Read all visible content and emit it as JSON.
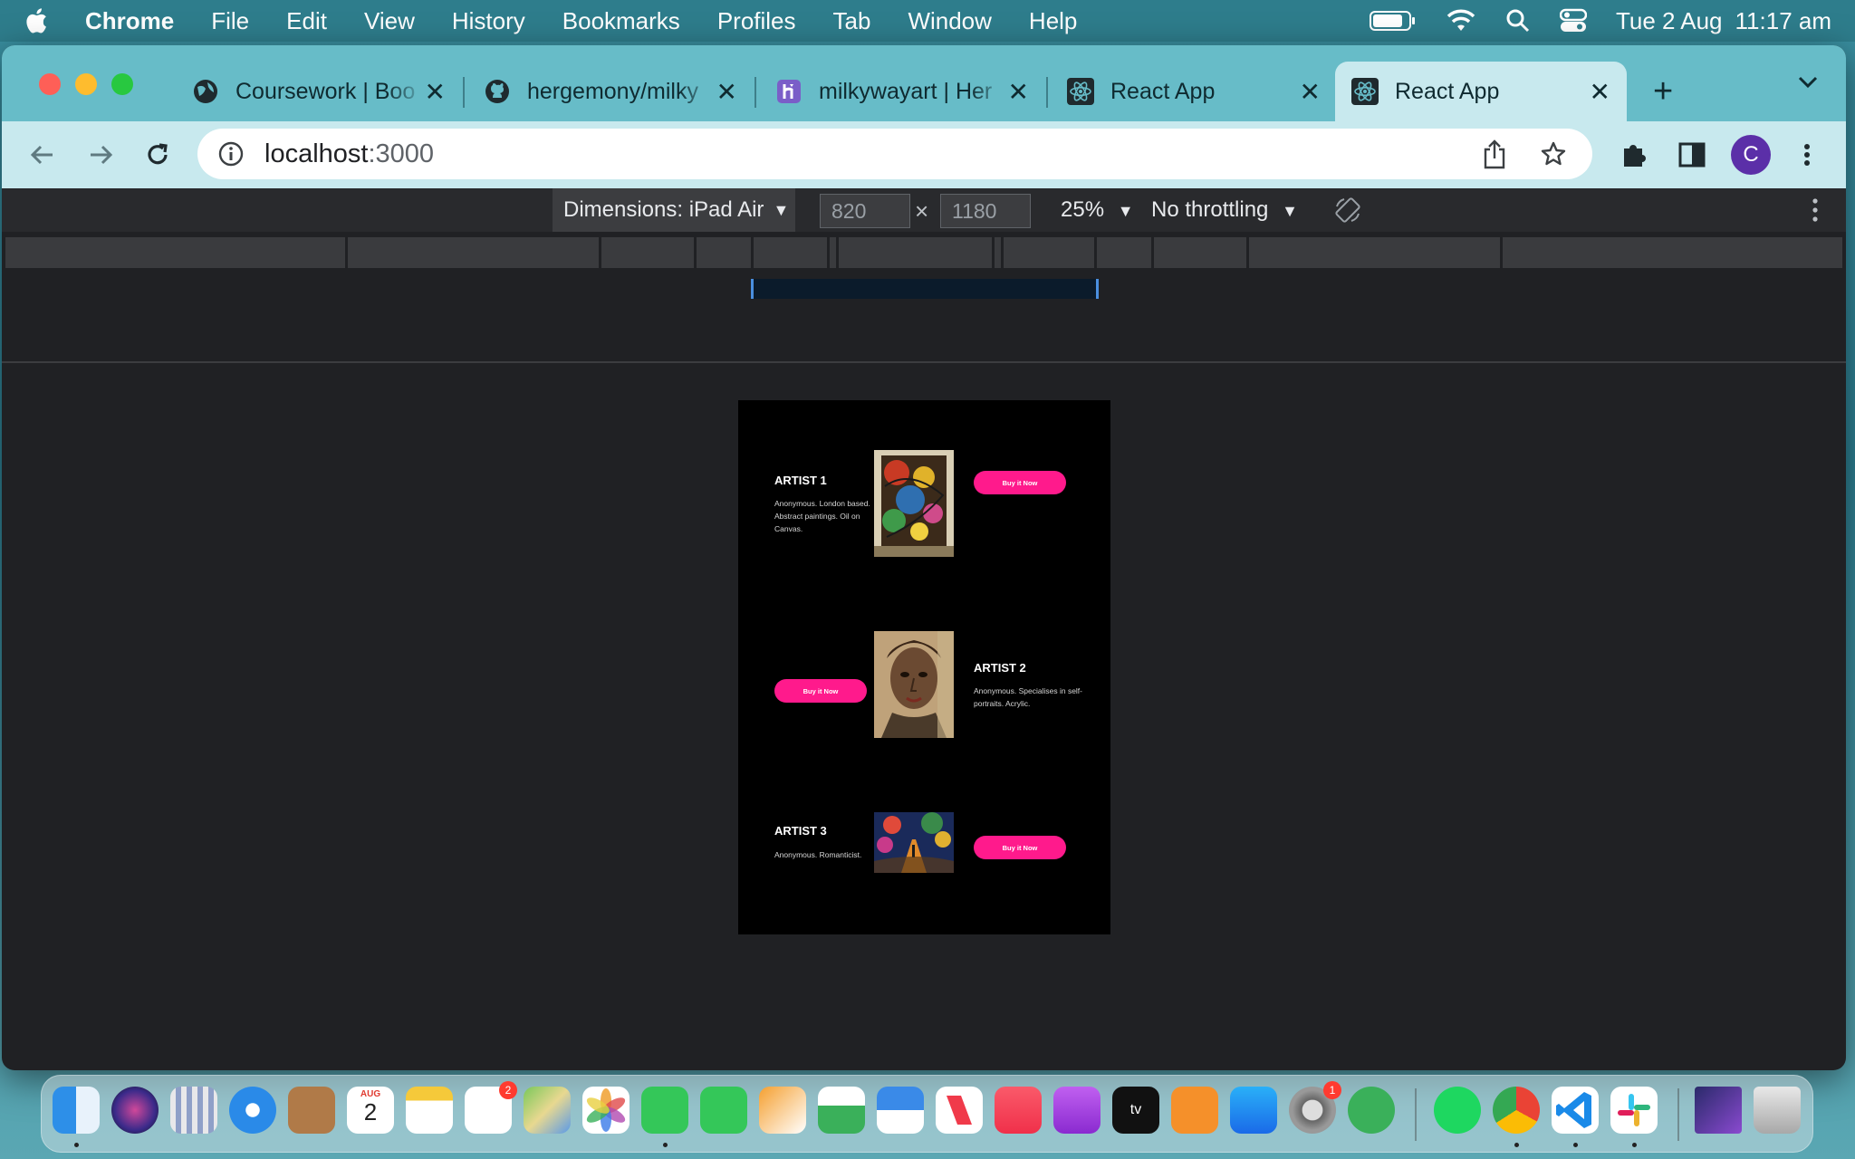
{
  "menubar": {
    "items": [
      "Chrome",
      "File",
      "Edit",
      "View",
      "History",
      "Bookmarks",
      "Profiles",
      "Tab",
      "Window",
      "Help"
    ],
    "date": "Tue 2 Aug",
    "time": "11:17 am"
  },
  "browser": {
    "tabs": [
      {
        "title": "Coursework | Boo",
        "icon": "globe-icon"
      },
      {
        "title": "hergemony/milky",
        "icon": "github-icon"
      },
      {
        "title": "milkywayart | Her",
        "icon": "heroku-icon"
      },
      {
        "title": "React App",
        "icon": "react-icon"
      },
      {
        "title": "React App",
        "icon": "react-icon"
      }
    ],
    "url_host": "localhost",
    "url_port": ":3000",
    "profile_initial": "C"
  },
  "devtools": {
    "dimensions_label": "Dimensions: iPad Air",
    "width": "820",
    "height": "1180",
    "times": "×",
    "zoom": "25%",
    "throttling": "No throttling"
  },
  "page": {
    "artists": [
      {
        "name": "ARTIST 1",
        "description": "Anonymous. London based. Abstract paintings. Oil on Canvas.",
        "button": "Buy it Now"
      },
      {
        "name": "ARTIST 2",
        "description": "Anonymous. Specialises in self-portraits. Acrylic.",
        "button": "Buy it Now"
      },
      {
        "name": "ARTIST 3",
        "description": "Anonymous. Romanticist.",
        "button": "Buy it Now"
      }
    ]
  },
  "dock": {
    "apps": [
      "finder-icon",
      "siri-icon",
      "launchpad-icon",
      "safari-icon",
      "contacts-icon",
      "calendar-icon",
      "notes-icon",
      "reminders-icon",
      "maps-icon",
      "photos-icon",
      "messages-icon",
      "facetime-icon",
      "pages-icon",
      "numbers-icon",
      "keynote-icon",
      "news-icon",
      "music-icon",
      "podcasts-icon",
      "tv-icon",
      "books-icon",
      "app-store-icon",
      "system-preferences-icon",
      "android-studio-icon",
      "spotify-icon",
      "chrome-icon",
      "vscode-icon",
      "slack-icon",
      "screenshot-folder-icon",
      "trash-icon"
    ],
    "calendar_month": "AUG",
    "calendar_day": "2",
    "reminders_badge": "2",
    "preferences_badge": "1"
  }
}
